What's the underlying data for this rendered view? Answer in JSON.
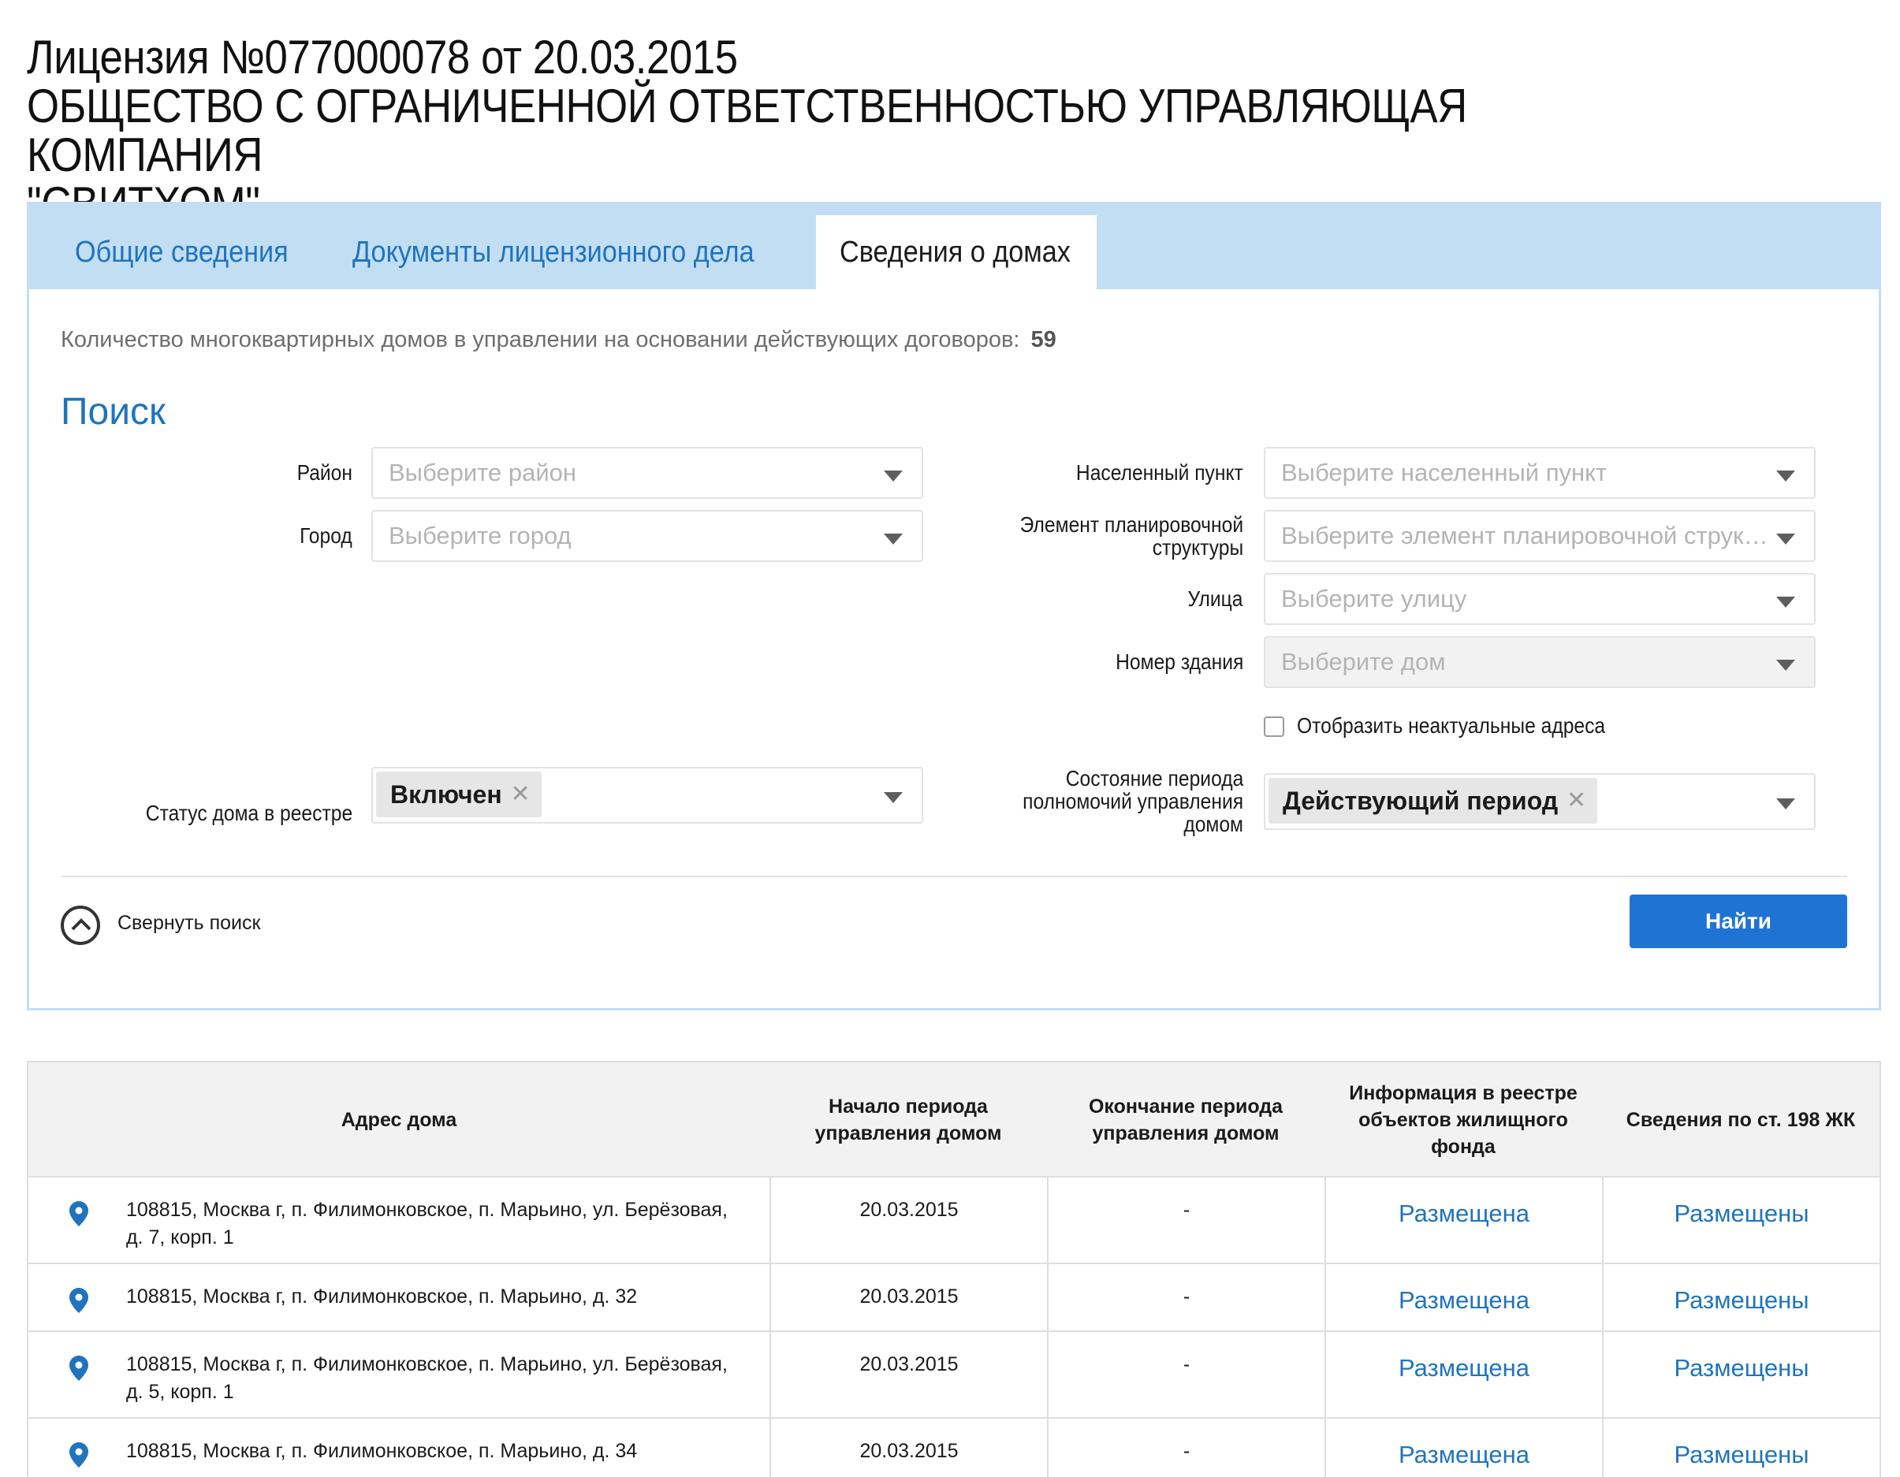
{
  "header": {
    "title_line1": "Лицензия №077000078 от 20.03.2015",
    "title_line2": "ОБЩЕСТВО С ОГРАНИЧЕННОЙ ОТВЕТСТВЕННОСТЬЮ УПРАВЛЯЮЩАЯ КОМПАНИЯ",
    "title_line3": "\"СВИТХОМ\""
  },
  "tabs": [
    {
      "label": "Общие сведения",
      "active": false
    },
    {
      "label": "Документы лицензионного дела",
      "active": false
    },
    {
      "label": "Сведения о домах",
      "active": true
    }
  ],
  "summary": {
    "label": "Количество многоквартирных домов в управлении на основании действующих договоров:",
    "value": "59"
  },
  "search": {
    "heading": "Поиск",
    "district": {
      "label": "Район",
      "placeholder": "Выберите район"
    },
    "city": {
      "label": "Город",
      "placeholder": "Выберите город"
    },
    "settlement": {
      "label": "Населенный пункт",
      "placeholder": "Выберите населенный пункт"
    },
    "planning_element": {
      "label_line1": "Элемент планировочной",
      "label_line2": "структуры",
      "placeholder": "Выберите элемент планировочной струк…"
    },
    "street": {
      "label": "Улица",
      "placeholder": "Выберите улицу"
    },
    "building": {
      "label": "Номер здания",
      "placeholder": "Выберите дом"
    },
    "show_outdated_label": "Отобразить неактуальные адреса",
    "status": {
      "label": "Статус дома в реестре",
      "value": "Включен"
    },
    "period_state": {
      "label_line1": "Состояние периода",
      "label_line2": "полномочий управления",
      "label_line3": "домом",
      "value": "Действующий период"
    },
    "collapse_label": "Свернуть поиск",
    "find_label": "Найти"
  },
  "table": {
    "headers": {
      "address": "Адрес дома",
      "start_line1": "Начало периода",
      "start_line2": "управления домом",
      "end_line1": "Окончание периода",
      "end_line2": "управления домом",
      "registry_line1": "Информация в реестре",
      "registry_line2": "объектов жилищного",
      "registry_line3": "фонда",
      "art198": "Сведения по ст. 198 ЖК"
    },
    "rows": [
      {
        "address_line1": "108815, Москва г, п. Филимонковское, п. Марьино, ул. Берёзовая,",
        "address_line2": "д. 7, корп. 1",
        "start": "20.03.2015",
        "end": "-",
        "registry": "Размещена",
        "art198": "Размещены"
      },
      {
        "address_line1": "108815, Москва г, п. Филимонковское, п. Марьино, д. 32",
        "address_line2": "",
        "start": "20.03.2015",
        "end": "-",
        "registry": "Размещена",
        "art198": "Размещены"
      },
      {
        "address_line1": "108815, Москва г, п. Филимонковское, п. Марьино, ул. Берёзовая,",
        "address_line2": "д. 5, корп. 1",
        "start": "20.03.2015",
        "end": "-",
        "registry": "Размещена",
        "art198": "Размещены"
      },
      {
        "address_line1": "108815, Москва г, п. Филимонковское, п. Марьино, д. 34",
        "address_line2": "",
        "start": "20.03.2015",
        "end": "-",
        "registry": "Размещена",
        "art198": "Размещены"
      }
    ]
  },
  "colors": {
    "accent": "#1f74bd",
    "button": "#1f74d3",
    "tabbar": "#c2def3"
  }
}
